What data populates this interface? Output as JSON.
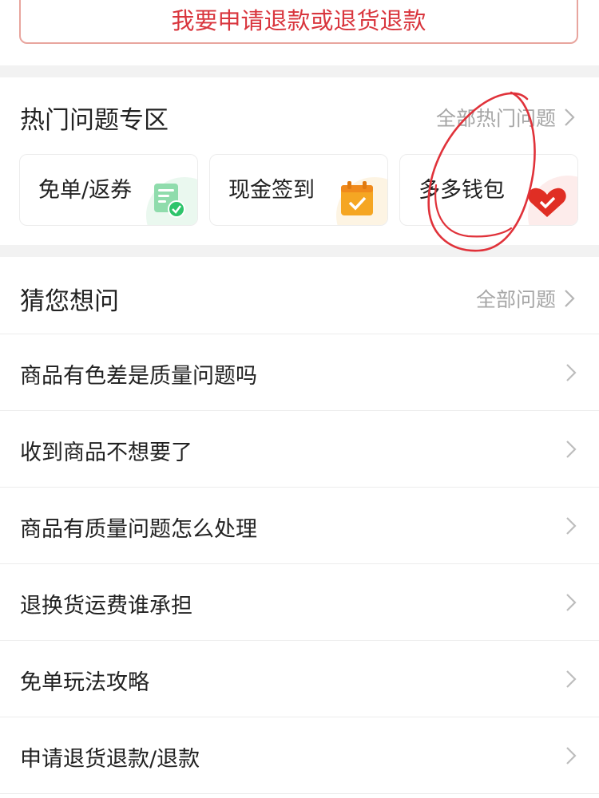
{
  "refund_button": {
    "label": "我要申请退款或退货退款"
  },
  "hot_section": {
    "title": "热门问题专区",
    "more_label": "全部热门问题",
    "cards": [
      {
        "label": "免单/返券",
        "icon": "coupon-icon",
        "accent": "#2ec46b"
      },
      {
        "label": "现金签到",
        "icon": "calendar-check-icon",
        "accent": "#f5a623"
      },
      {
        "label": "多多钱包",
        "icon": "heart-wallet-icon",
        "accent": "#e02e24"
      }
    ]
  },
  "guess_section": {
    "title": "猜您想问",
    "more_label": "全部问题",
    "questions": [
      "商品有色差是质量问题吗",
      "收到商品不想要了",
      "商品有质量问题怎么处理",
      "退换货运费谁承担",
      "免单玩法攻略",
      "申请退货退款/退款"
    ]
  },
  "colors": {
    "accent_red": "#d9363e",
    "text_main": "#222222",
    "text_muted": "#a6a6a6",
    "divider": "#ececec",
    "gap": "#f2f2f2",
    "annotation": "#e0323a"
  },
  "annotation": {
    "shape": "hand-drawn circle",
    "target": "多多钱包"
  }
}
